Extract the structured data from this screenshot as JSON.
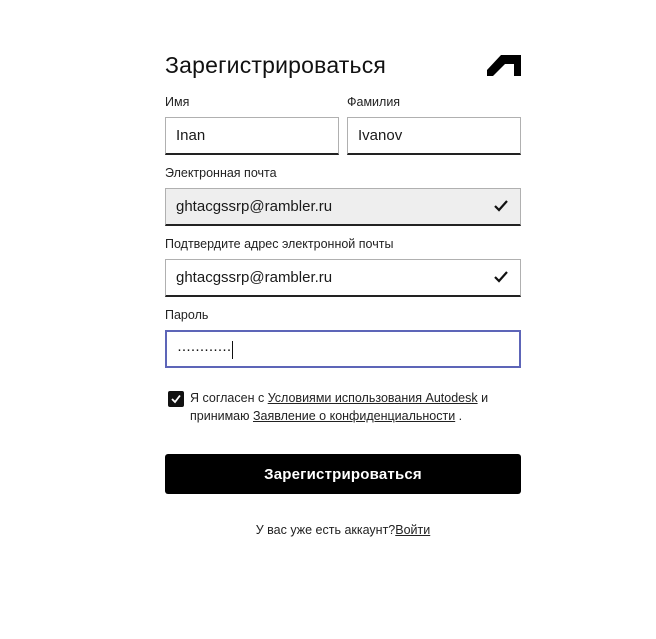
{
  "header": {
    "title": "Зарегистрироваться",
    "logo_icon": "autodesk-logo-icon"
  },
  "form": {
    "first_name": {
      "label": "Имя",
      "value": "Inan"
    },
    "last_name": {
      "label": "Фамилия",
      "value": "Ivanov"
    },
    "email": {
      "label": "Электронная почта",
      "value": "ghtacgssrp@rambler.ru",
      "valid": true
    },
    "email_confirm": {
      "label": "Подтвердите адрес электронной почты",
      "value": "ghtacgssrp@rambler.ru",
      "valid": true
    },
    "password": {
      "label": "Пароль",
      "masked_value": "············"
    },
    "agreement": {
      "checked": true,
      "text_before": "Я согласен с ",
      "terms_link": "Условиями использования Autodesk",
      "text_middle": " и принимаю ",
      "privacy_link": "Заявление о конфиденциальности",
      "text_after": " ."
    },
    "submit_label": "Зарегистрироваться"
  },
  "footer": {
    "have_account_text": "У вас уже есть аккаунт?",
    "signin_link": "Войти"
  },
  "colors": {
    "focus_border": "#5d65b8",
    "button_bg": "#000000",
    "readonly_bg": "#eeeeee"
  }
}
